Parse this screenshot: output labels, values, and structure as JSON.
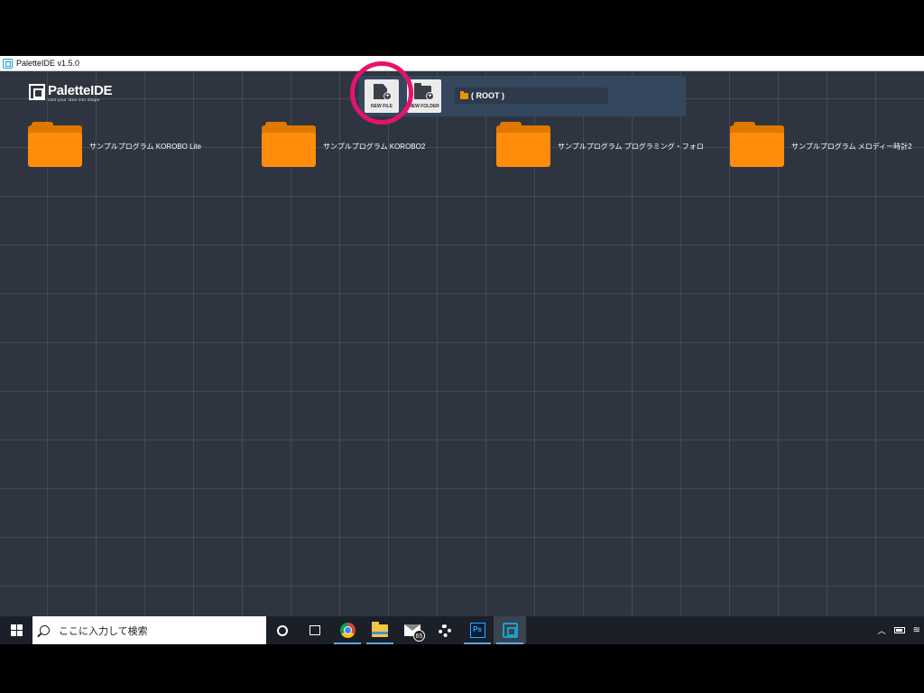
{
  "window": {
    "title": "PaletteIDE v1.5.0"
  },
  "logo": {
    "name": "PaletteIDE",
    "tagline": "cast your idea into shape"
  },
  "toolbar": {
    "new_file_label": "NEW FILE",
    "new_folder_label": "NEW FOLDER",
    "path": "( ROOT )"
  },
  "folders": [
    {
      "name": "サンプルプログラム KOROBO Lite"
    },
    {
      "name": "サンプルプログラム KOROBO2"
    },
    {
      "name": "サンプルプログラム プログラミング・フォロ"
    },
    {
      "name": "サンプルプログラム メロディー時計2"
    }
  ],
  "taskbar": {
    "search_placeholder": "ここに入力して検索",
    "mail_badge": "65",
    "photoshop_label": "Ps",
    "apps": [
      "cortana-icon",
      "task-view-icon",
      "chrome-icon",
      "file-explorer-icon",
      "mail-icon",
      "settings-icon",
      "photoshop-icon",
      "paletteide-icon"
    ]
  },
  "colors": {
    "workspace_bg": "#2f3540",
    "folder": "#ff8c0a",
    "highlight_ring": "#e5136b",
    "toolbar_panel": "#34475d"
  }
}
